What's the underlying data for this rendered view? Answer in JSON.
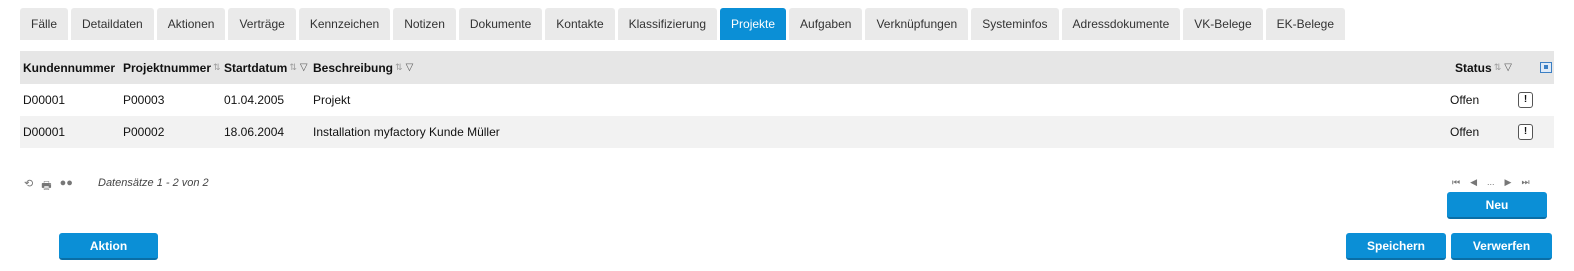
{
  "tabs": [
    {
      "label": "Fälle"
    },
    {
      "label": "Detaildaten"
    },
    {
      "label": "Aktionen"
    },
    {
      "label": "Verträge"
    },
    {
      "label": "Kennzeichen"
    },
    {
      "label": "Notizen"
    },
    {
      "label": "Dokumente"
    },
    {
      "label": "Kontakte"
    },
    {
      "label": "Klassifizierung"
    },
    {
      "label": "Projekte",
      "active": true
    },
    {
      "label": "Aufgaben"
    },
    {
      "label": "Verknüpfungen"
    },
    {
      "label": "Systeminfos"
    },
    {
      "label": "Adressdokumente"
    },
    {
      "label": "VK-Belege"
    },
    {
      "label": "EK-Belege"
    }
  ],
  "grid": {
    "columns": {
      "kundennummer": "Kundennummer",
      "projektnummer": "Projektnummer",
      "startdatum": "Startdatum",
      "beschreibung": "Beschreibung",
      "status": "Status"
    },
    "rows": [
      {
        "kundennummer": "D00001",
        "projektnummer": "P00003",
        "startdatum": "01.04.2005",
        "beschreibung": "Projekt",
        "status": "Offen"
      },
      {
        "kundennummer": "D00001",
        "projektnummer": "P00002",
        "startdatum": "18.06.2004",
        "beschreibung": "Installation myfactory Kunde Müller",
        "status": "Offen"
      }
    ],
    "records_text": "Datensätze 1 - 2 von 2",
    "row_action_glyph": "!"
  },
  "pager": {
    "first": "⏮",
    "prev": "◀",
    "ellipsis": "...",
    "next": "▶",
    "last": "⏭"
  },
  "buttons": {
    "neu": "Neu",
    "aktion": "Aktion",
    "speichern": "Speichern",
    "verwerfen": "Verwerfen"
  },
  "icons": {
    "refresh": "⟲",
    "print": "🖶",
    "options": "●●",
    "sort": "⇅",
    "filter": "▽"
  },
  "colors": {
    "accent": "#0b8fd6"
  }
}
